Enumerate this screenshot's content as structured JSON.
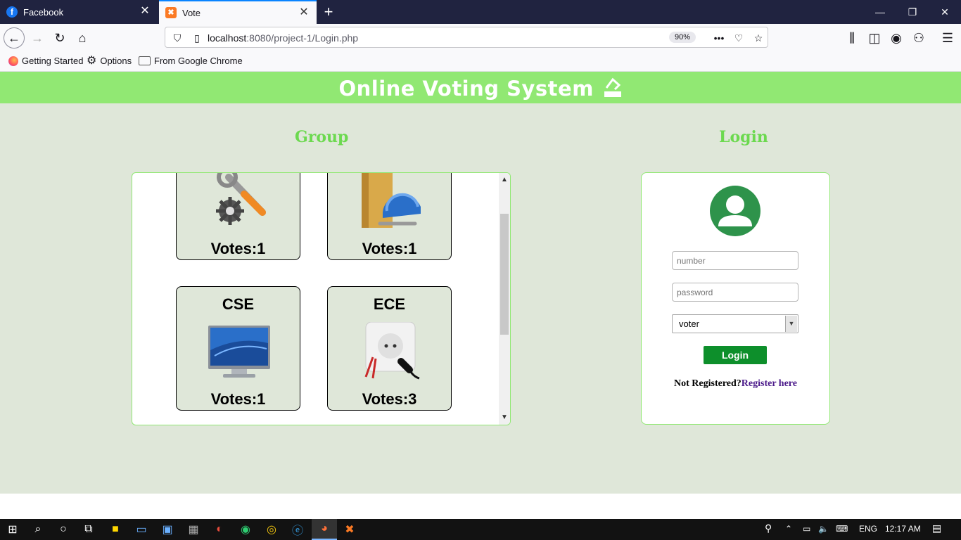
{
  "browser": {
    "tabs": [
      {
        "label": "Facebook",
        "icon": "facebook-icon"
      },
      {
        "label": "Vote",
        "icon": "xampp-icon"
      }
    ],
    "url": {
      "host": "localhost",
      "path": ":8080/project-1/Login.php"
    },
    "zoom": "90%",
    "bookmarks": [
      {
        "label": "Getting Started",
        "icon": "firefox-icon"
      },
      {
        "label": "Options",
        "icon": "gear-icon"
      },
      {
        "label": "From Google Chrome",
        "icon": "folder-icon"
      }
    ]
  },
  "page": {
    "title": "Online Voting System",
    "colors": {
      "header": "#91e873",
      "background": "#dfe7d9",
      "accent": "#6cd94f",
      "button": "#0d8f2b"
    },
    "group": {
      "heading": "Group",
      "cards": [
        {
          "name": "",
          "votes": "Votes:1",
          "icon": "wrench-gear-icon"
        },
        {
          "name": "",
          "votes": "Votes:1",
          "icon": "folder-helmet-icon"
        },
        {
          "name": "CSE",
          "votes": "Votes:1",
          "icon": "monitor-icon"
        },
        {
          "name": "ECE",
          "votes": "Votes:3",
          "icon": "power-socket-icon"
        }
      ]
    },
    "login": {
      "heading": "Login",
      "number_placeholder": "number",
      "password_placeholder": "password",
      "role_selected": "voter",
      "button": "Login",
      "not_registered": "Not Registered?",
      "register_link": "Register here"
    }
  },
  "taskbar": {
    "language": "ENG",
    "time": "12:17 AM"
  }
}
